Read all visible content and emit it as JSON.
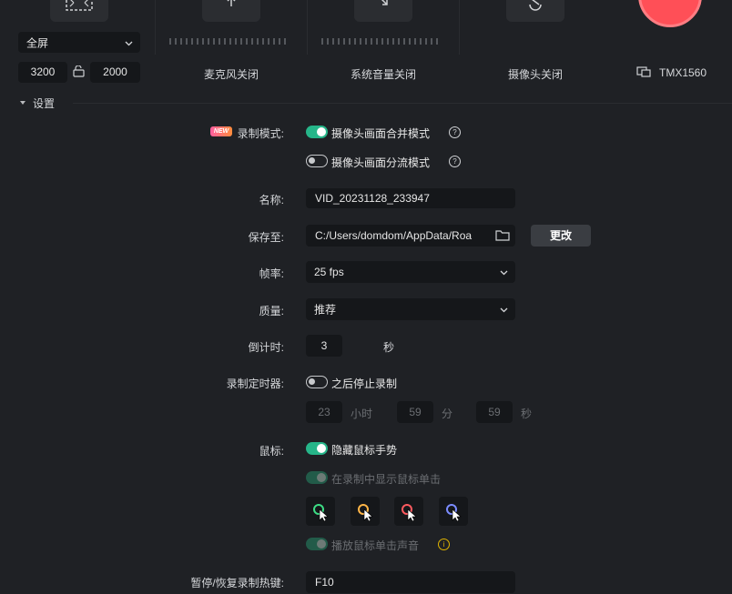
{
  "top": {
    "region_select": {
      "value": "全屏"
    },
    "width": "3200",
    "height": "2000",
    "devices": [
      {
        "label": "麦克风关闭"
      },
      {
        "label": "系统音量关闭"
      },
      {
        "label": "摄像头关闭"
      }
    ],
    "monitor_label": "TMX1560"
  },
  "settings": {
    "title": "设置",
    "record_mode": {
      "label": "录制模式:",
      "badge": "NEW",
      "options": [
        {
          "label": "摄像头画面合并模式",
          "on": true
        },
        {
          "label": "摄像头画面分流模式",
          "on": false
        }
      ]
    },
    "name": {
      "label": "名称:",
      "value": "VID_20231128_233947"
    },
    "save_to": {
      "label": "保存至:",
      "value": "C:/Users/domdom/AppData/Roa",
      "button": "更改"
    },
    "fps": {
      "label": "帧率:",
      "value": "25 fps"
    },
    "quality": {
      "label": "质量:",
      "value": "推荐"
    },
    "countdown": {
      "label": "倒计时:",
      "value": "3",
      "unit": "秒"
    },
    "timer": {
      "label": "录制定时器:",
      "toggle_label": "之后停止录制",
      "hours": "23",
      "hours_unit": "小时",
      "minutes": "59",
      "minutes_unit": "分",
      "seconds": "59",
      "seconds_unit": "秒"
    },
    "mouse": {
      "label": "鼠标:",
      "hide_gesture": "隐藏鼠标手势",
      "show_clicks": "在录制中显示鼠标单击",
      "play_sound": "播放鼠标单击声音",
      "cursor_colors": [
        "#3ddc84",
        "#ffb547",
        "#ff5a5f",
        "#7b8cff"
      ]
    },
    "hotkey": {
      "label": "暂停/恢复录制热键:",
      "value": "F10"
    }
  }
}
